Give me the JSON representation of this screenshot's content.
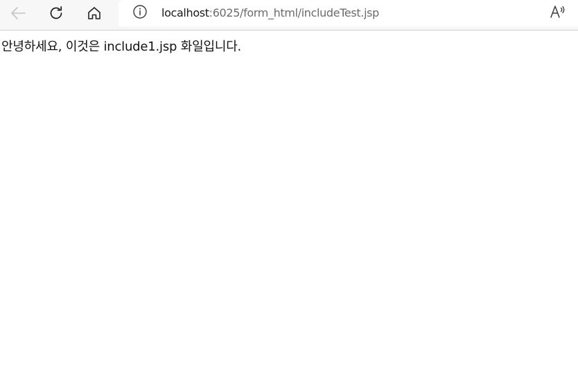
{
  "browser": {
    "url_host": "localhost",
    "url_path": ":6025/form_html/includeTest.jsp",
    "icons": {
      "back": "arrow-left-icon",
      "refresh": "refresh-icon",
      "home": "home-icon",
      "site_info": "info-circle-icon",
      "read_aloud": "read-aloud-icon"
    },
    "back_enabled": false
  },
  "page": {
    "text": "안녕하세요, 이것은 include1.jsp 화일입니다."
  },
  "colors": {
    "toolbar_bg": "#f7f7f7",
    "icon_active": "#1f1f1f",
    "icon_disabled": "#c4c4c4",
    "url_path": "#6b6b6b"
  }
}
